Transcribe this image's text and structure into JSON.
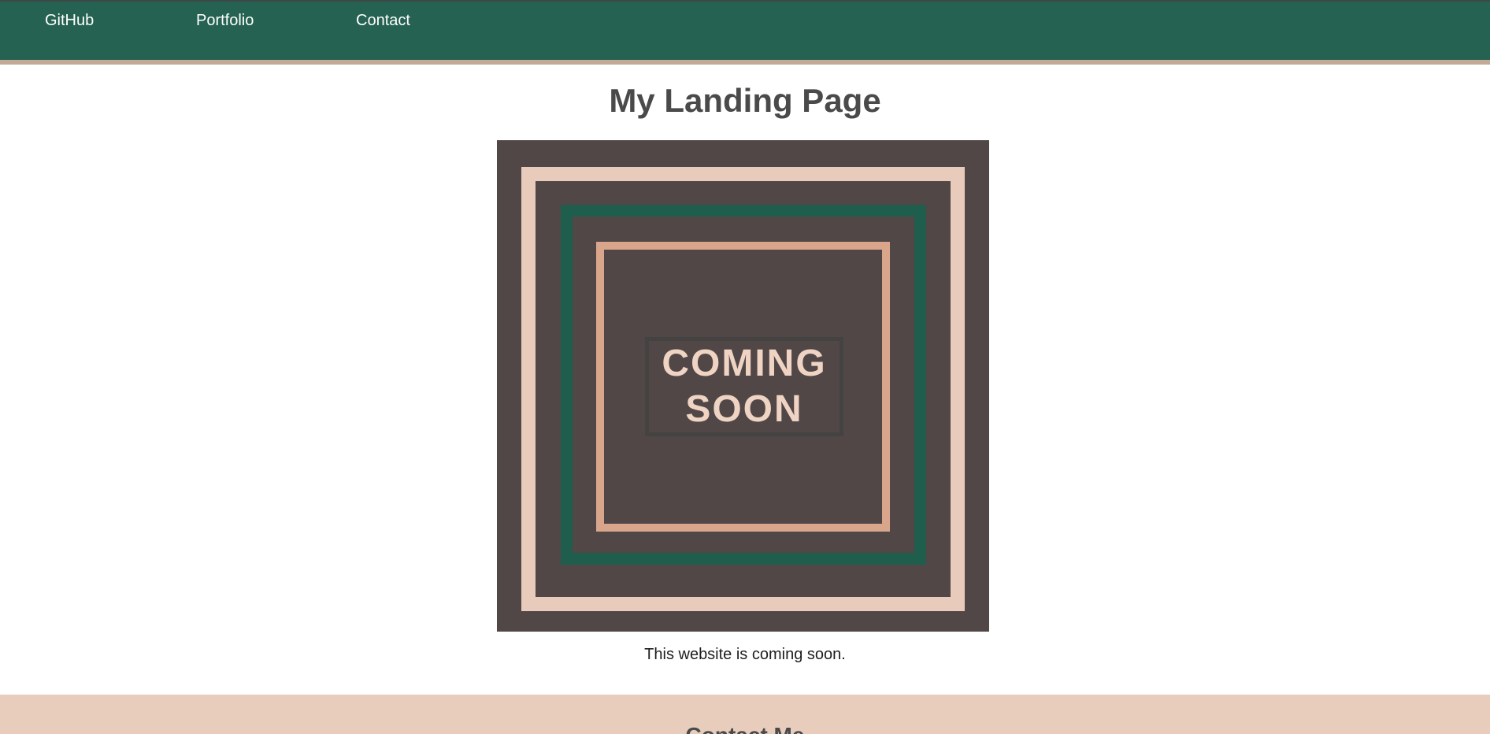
{
  "nav": {
    "links": [
      {
        "label": "GitHub"
      },
      {
        "label": "Portfolio"
      },
      {
        "label": "Contact"
      }
    ]
  },
  "page": {
    "title": "My Landing Page",
    "subtitle": "This website is coming soon."
  },
  "hero": {
    "badge_line_1": "COMING",
    "badge_line_2": "SOON"
  },
  "footer": {
    "heading": "Contact Me"
  },
  "colors": {
    "header_bg": "#256251",
    "header_stripe": "#c3aa96",
    "hero_bg": "#514747",
    "frame_outer": "#e8cbbb",
    "frame_green": "#1f5e4c",
    "frame_inner": "#d9a58b",
    "footer_bg": "#e8cdbd",
    "heading_text": "#4a4a4a"
  }
}
